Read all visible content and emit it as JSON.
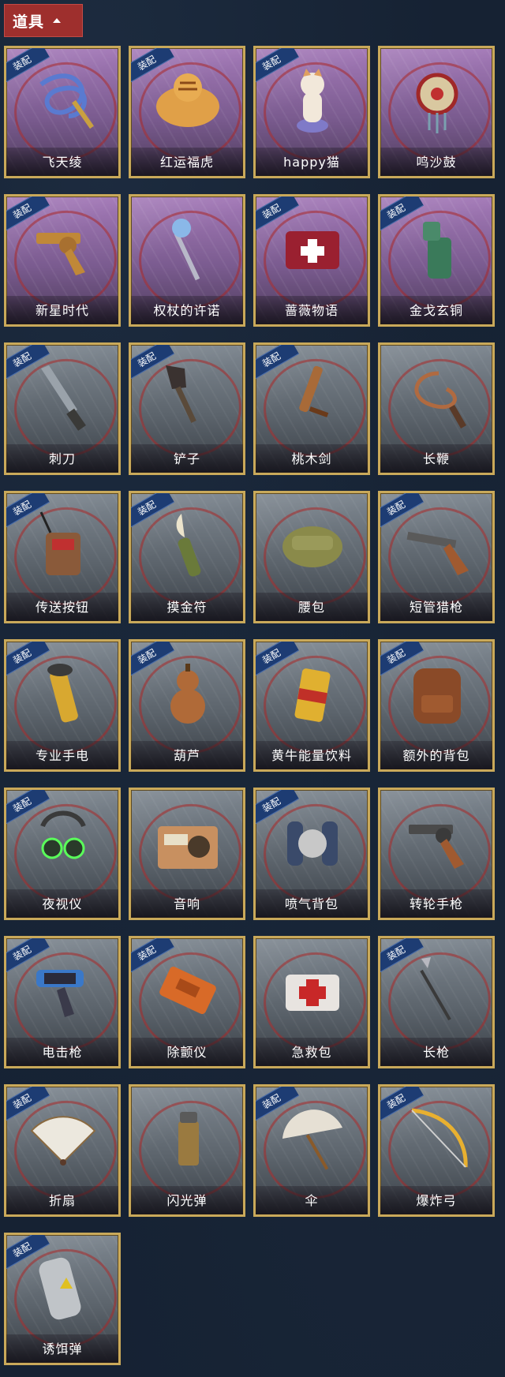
{
  "section": {
    "title": "道具"
  },
  "equip_tag": "装配",
  "items": [
    {
      "label": "飞天绫",
      "tier": "purple",
      "equipped": true,
      "icon": "ribbon-icon"
    },
    {
      "label": "红运福虎",
      "tier": "purple",
      "equipped": true,
      "icon": "tiger-icon"
    },
    {
      "label": "happy猫",
      "tier": "purple",
      "equipped": true,
      "icon": "cat-icon"
    },
    {
      "label": "鸣沙鼓",
      "tier": "purple",
      "equipped": false,
      "icon": "drum-icon"
    },
    {
      "label": "新星时代",
      "tier": "purple",
      "equipped": true,
      "icon": "revolver-icon"
    },
    {
      "label": "权杖的许诺",
      "tier": "purple",
      "equipped": false,
      "icon": "scepter-icon"
    },
    {
      "label": "蔷薇物语",
      "tier": "purple",
      "equipped": true,
      "icon": "medkit-icon"
    },
    {
      "label": "金戈玄铜",
      "tier": "purple",
      "equipped": true,
      "icon": "bronze-grenade-icon"
    },
    {
      "label": "刺刀",
      "tier": "gray",
      "equipped": true,
      "icon": "knife-icon"
    },
    {
      "label": "铲子",
      "tier": "gray",
      "equipped": true,
      "icon": "shovel-icon"
    },
    {
      "label": "桃木剑",
      "tier": "gray",
      "equipped": true,
      "icon": "wooden-sword-icon"
    },
    {
      "label": "长鞭",
      "tier": "gray",
      "equipped": false,
      "icon": "whip-icon"
    },
    {
      "label": "传送按钮",
      "tier": "gray",
      "equipped": true,
      "icon": "remote-icon"
    },
    {
      "label": "摸金符",
      "tier": "gray",
      "equipped": true,
      "icon": "talisman-icon"
    },
    {
      "label": "腰包",
      "tier": "gray",
      "equipped": false,
      "icon": "waist-bag-icon"
    },
    {
      "label": "短管猎枪",
      "tier": "gray",
      "equipped": true,
      "icon": "shotgun-icon"
    },
    {
      "label": "专业手电",
      "tier": "gray",
      "equipped": true,
      "icon": "flashlight-icon"
    },
    {
      "label": "葫芦",
      "tier": "gray",
      "equipped": true,
      "icon": "gourd-icon"
    },
    {
      "label": "黄牛能量饮料",
      "tier": "gray",
      "equipped": true,
      "icon": "energy-drink-icon"
    },
    {
      "label": "额外的背包",
      "tier": "gray",
      "equipped": true,
      "icon": "backpack-icon"
    },
    {
      "label": "夜视仪",
      "tier": "gray",
      "equipped": true,
      "icon": "night-vision-icon"
    },
    {
      "label": "音响",
      "tier": "gray",
      "equipped": false,
      "icon": "radio-icon"
    },
    {
      "label": "喷气背包",
      "tier": "gray",
      "equipped": true,
      "icon": "jetpack-icon"
    },
    {
      "label": "转轮手枪",
      "tier": "gray",
      "equipped": false,
      "icon": "pistol-icon"
    },
    {
      "label": "电击枪",
      "tier": "gray",
      "equipped": true,
      "icon": "shock-gun-icon"
    },
    {
      "label": "除颤仪",
      "tier": "gray",
      "equipped": true,
      "icon": "defibrillator-icon"
    },
    {
      "label": "急救包",
      "tier": "gray",
      "equipped": false,
      "icon": "first-aid-icon"
    },
    {
      "label": "长枪",
      "tier": "gray",
      "equipped": true,
      "icon": "spear-icon"
    },
    {
      "label": "折扇",
      "tier": "gray",
      "equipped": true,
      "icon": "fan-icon"
    },
    {
      "label": "闪光弹",
      "tier": "gray",
      "equipped": false,
      "icon": "flashbang-icon"
    },
    {
      "label": "伞",
      "tier": "gray",
      "equipped": true,
      "icon": "umbrella-icon"
    },
    {
      "label": "爆炸弓",
      "tier": "gray",
      "equipped": true,
      "icon": "bow-icon"
    },
    {
      "label": "诱饵弹",
      "tier": "gray",
      "equipped": true,
      "icon": "decoy-icon"
    }
  ],
  "colors": {
    "header_bg": "#9e2f2d",
    "frame_gold": "#c9a95a",
    "tag_blue": "#1d3c73",
    "page_bg": "#162233"
  }
}
